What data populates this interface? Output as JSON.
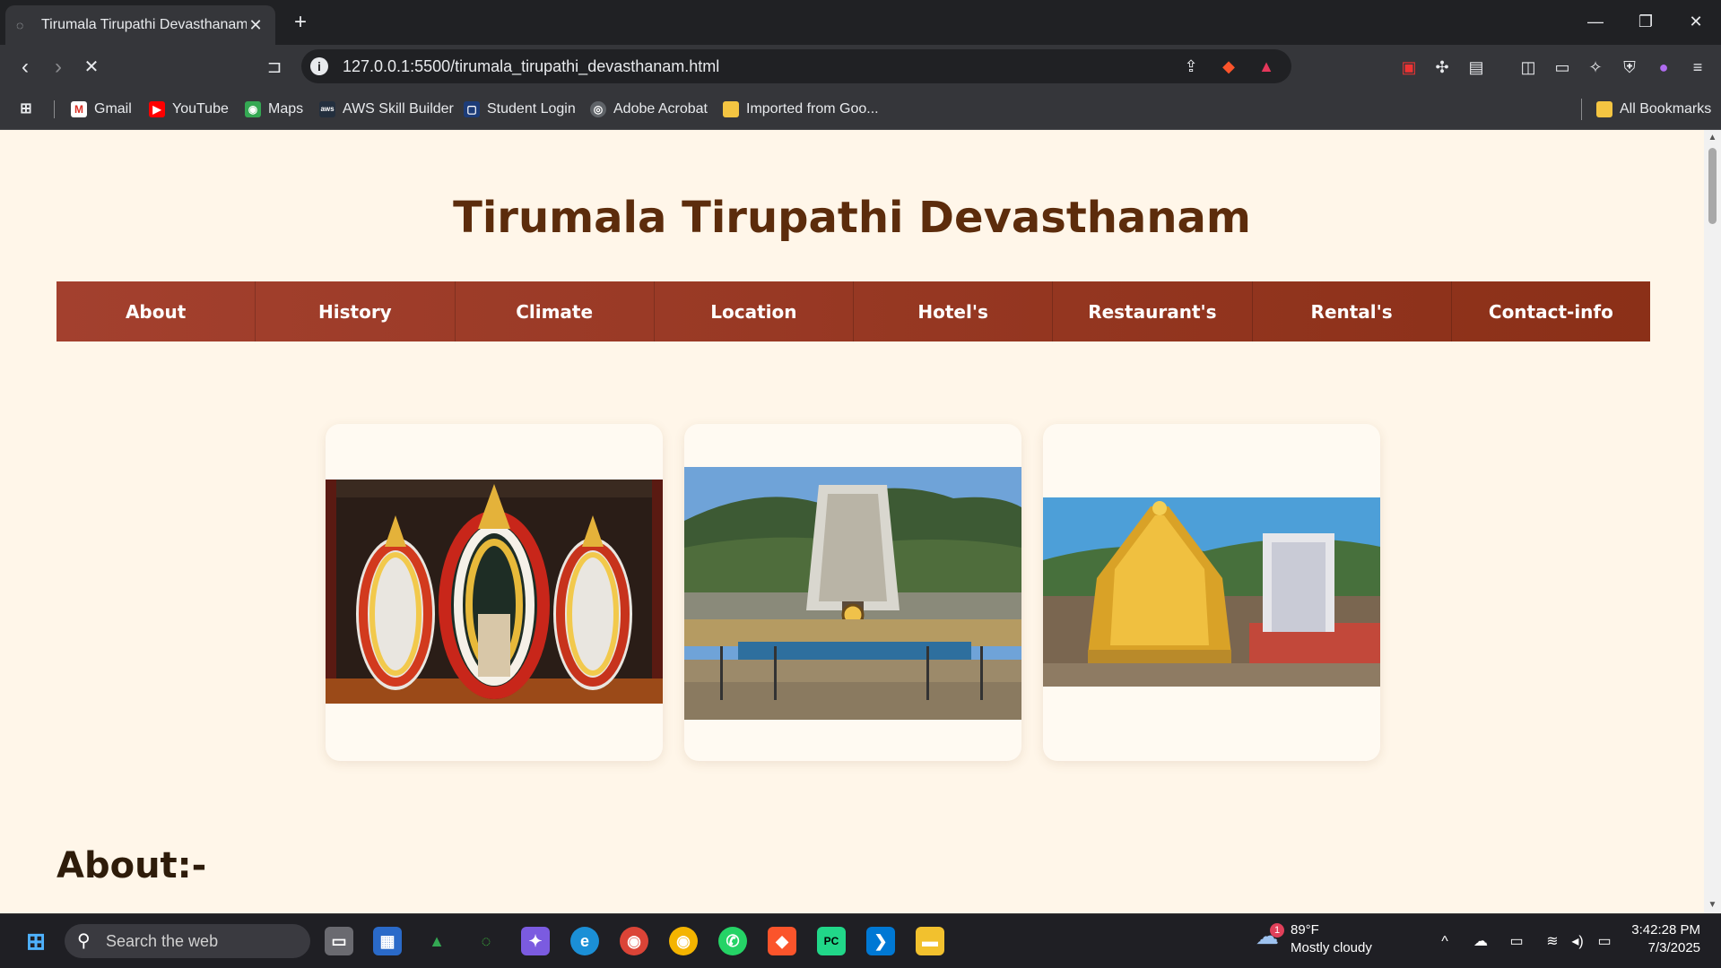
{
  "browser": {
    "tab_title": "Tirumala Tirupathi Devasthanam",
    "url": "127.0.0.1:5500/tirumala_tirupathi_devasthanam.html",
    "bookmarks": [
      {
        "label": "Gmail",
        "icon": "gmail-icon"
      },
      {
        "label": "YouTube",
        "icon": "youtube-icon"
      },
      {
        "label": "Maps",
        "icon": "maps-icon"
      },
      {
        "label": "AWS Skill Builder",
        "icon": "aws-icon"
      },
      {
        "label": "Student Login",
        "icon": "student-login-icon"
      },
      {
        "label": "Adobe Acrobat",
        "icon": "acrobat-icon"
      },
      {
        "label": "Imported from Goo...",
        "icon": "folder-icon"
      }
    ],
    "all_bookmarks": "All Bookmarks"
  },
  "page": {
    "title": "Tirumala Tirupathi Devasthanam",
    "nav": [
      "About",
      "History",
      "Climate",
      "Location",
      "Hotel's",
      "Restaurant's",
      "Rental's",
      "Contact-info"
    ],
    "about_heading": "About:-"
  },
  "taskbar": {
    "search_placeholder": "Search the web",
    "weather_temp": "89°F",
    "weather_desc": "Mostly cloudy",
    "weather_badge": "1",
    "time": "3:42:28 PM",
    "date": "7/3/2025"
  },
  "colors": {
    "page_bg": "#fff6e9",
    "title": "#5c2c0c",
    "nav_bg": "#9b3a22"
  }
}
